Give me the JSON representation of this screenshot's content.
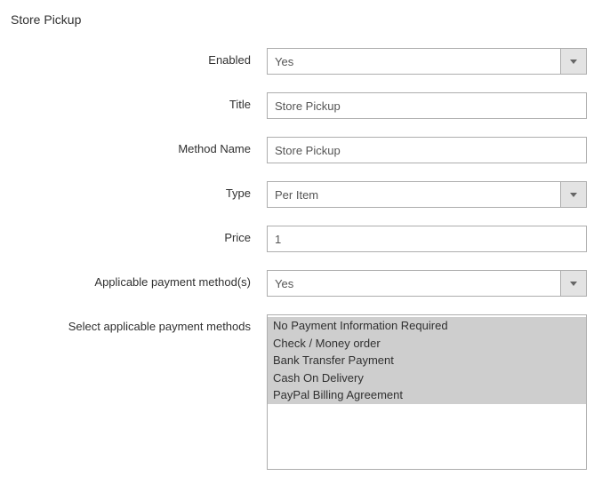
{
  "section": {
    "title": "Store Pickup"
  },
  "fields": {
    "enabled": {
      "label": "Enabled",
      "value": "Yes"
    },
    "title": {
      "label": "Title",
      "value": "Store Pickup"
    },
    "method": {
      "label": "Method Name",
      "value": "Store Pickup"
    },
    "type": {
      "label": "Type",
      "value": "Per Item"
    },
    "price": {
      "label": "Price",
      "value": "1"
    },
    "applicable": {
      "label": "Applicable payment method(s)",
      "value": "Yes"
    },
    "select_methods": {
      "label": "Select applicable payment methods",
      "options": [
        "No Payment Information Required",
        "Check / Money order",
        "Bank Transfer Payment",
        "Cash On Delivery",
        "PayPal Billing Agreement"
      ]
    }
  }
}
